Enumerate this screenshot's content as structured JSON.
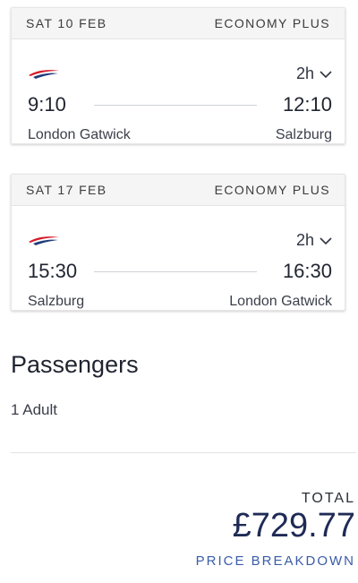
{
  "flights": [
    {
      "date": "SAT 10 FEB",
      "cabin": "ECONOMY PLUS",
      "duration": "2h",
      "depart_time": "9:10",
      "arrive_time": "12:10",
      "origin": "London Gatwick",
      "destination": "Salzburg",
      "airline_icon": "british-airways-logo"
    },
    {
      "date": "SAT 17 FEB",
      "cabin": "ECONOMY PLUS",
      "duration": "2h",
      "depart_time": "15:30",
      "arrive_time": "16:30",
      "origin": "Salzburg",
      "destination": "London Gatwick",
      "airline_icon": "british-airways-logo"
    }
  ],
  "passengers": {
    "title": "Passengers",
    "summary": "1 Adult"
  },
  "total": {
    "label": "TOTAL",
    "amount": "£729.77",
    "breakdown_link": "PRICE BREAKDOWN"
  },
  "colors": {
    "logo_red": "#d41c2b",
    "logo_blue": "#1f3c7a",
    "link": "#3a5ca8",
    "total_text": "#1f2b55"
  }
}
